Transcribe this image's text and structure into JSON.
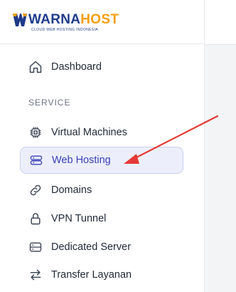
{
  "brand": {
    "name_part1": "WARNA",
    "name_part2": "HOST",
    "tagline": "CLOUD WEB HOSTING INDONESIA"
  },
  "nav": {
    "dashboard": "Dashboard",
    "section_service": "SERVICE",
    "items": [
      {
        "label": "Virtual Machines",
        "icon": "cpu-icon"
      },
      {
        "label": "Web Hosting",
        "icon": "server-stack-icon",
        "active": true
      },
      {
        "label": "Domains",
        "icon": "link-icon"
      },
      {
        "label": "VPN Tunnel",
        "icon": "lock-icon"
      },
      {
        "label": "Dedicated Server",
        "icon": "server-icon"
      },
      {
        "label": "Transfer Layanan",
        "icon": "arrows-transfer-icon"
      }
    ]
  },
  "colors": {
    "brand_dark": "#1e3a8a",
    "brand_accent": "#f59e0b",
    "active_bg": "#eceffb",
    "active_text": "#3b3fb8",
    "annotation_arrow": "#e53935"
  }
}
